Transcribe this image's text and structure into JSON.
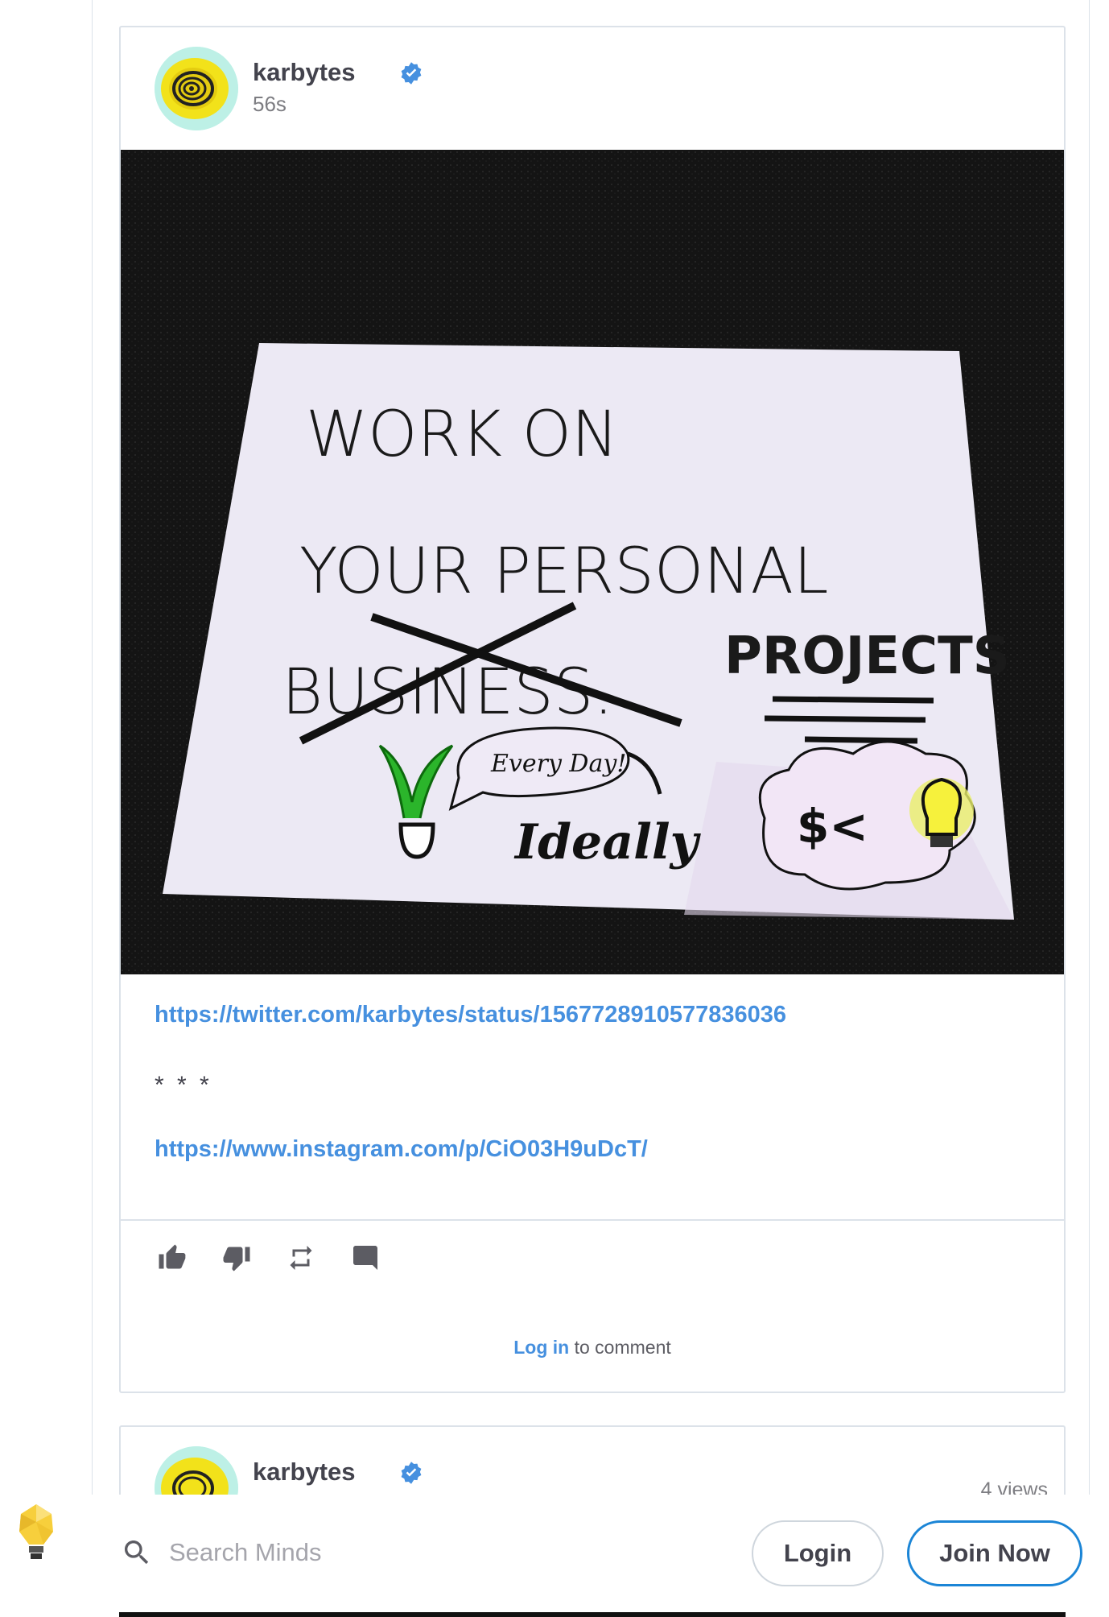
{
  "post1": {
    "owner": {
      "username": "karbytes",
      "timestamp": "56s",
      "verified": true
    },
    "media_text": {
      "line1": "WORK  ON",
      "line2": "YOUR  PERSONAL",
      "struck": "BUSINESS.",
      "replacement": "PROJECTS",
      "bubble": "Every Day!",
      "ideally": "Ideally",
      "thought": "$<"
    },
    "links": {
      "twitter": "https://twitter.com/karbytes/status/1567728910577836036",
      "separator": "* * *",
      "instagram": "https://www.instagram.com/p/CiO03H9uDcT/"
    },
    "comment": {
      "login_label": "Log in",
      "suffix": " to comment"
    }
  },
  "post2": {
    "owner": {
      "username": "karbytes",
      "verified": true
    },
    "views": "4 views"
  },
  "bottom_bar": {
    "search_placeholder": "Search Minds",
    "login_label": "Login",
    "join_label": "Join Now"
  },
  "colors": {
    "accent": "#4690df",
    "join_border": "#1b85d6",
    "text": "#43434d"
  }
}
